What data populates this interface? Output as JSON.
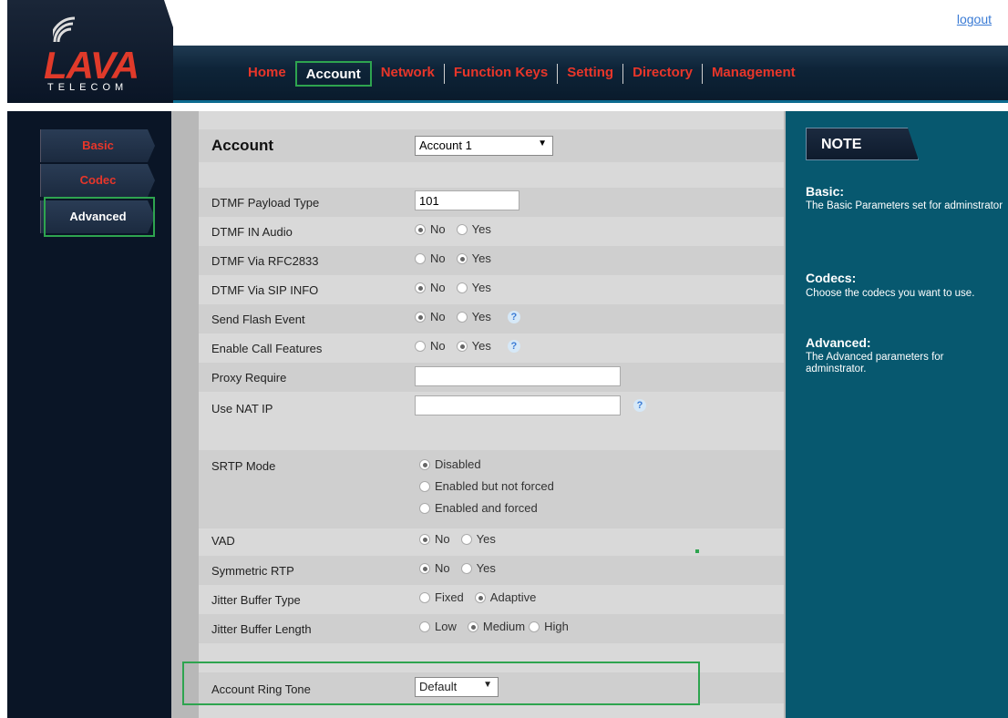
{
  "header": {
    "logout_label": "logout",
    "logo_text": "LAVA",
    "logo_sub": "TELECOM",
    "nav": [
      {
        "label": "Home"
      },
      {
        "label": "Account"
      },
      {
        "label": "Network"
      },
      {
        "label": "Function Keys"
      },
      {
        "label": "Setting"
      },
      {
        "label": "Directory"
      },
      {
        "label": "Management"
      }
    ],
    "active_nav": "Account"
  },
  "sidebar": {
    "items": [
      {
        "label": "Basic"
      },
      {
        "label": "Codec"
      },
      {
        "label": "Advanced"
      }
    ],
    "active": "Advanced"
  },
  "form": {
    "title": "Account",
    "account_select": "Account 1",
    "dtmf_payload_type": {
      "label": "DTMF Payload Type",
      "value": "101"
    },
    "dtmf_in_audio": {
      "label": "DTMF IN Audio",
      "options": [
        "No",
        "Yes"
      ],
      "selected": "No"
    },
    "dtmf_via_rfc2833": {
      "label": "DTMF Via RFC2833",
      "options": [
        "No",
        "Yes"
      ],
      "selected": "Yes"
    },
    "dtmf_via_sip_info": {
      "label": "DTMF Via SIP INFO",
      "options": [
        "No",
        "Yes"
      ],
      "selected": "No"
    },
    "send_flash_event": {
      "label": "Send Flash Event",
      "options": [
        "No",
        "Yes"
      ],
      "selected": "No"
    },
    "enable_call_features": {
      "label": "Enable Call Features",
      "options": [
        "No",
        "Yes"
      ],
      "selected": "Yes"
    },
    "proxy_require": {
      "label": "Proxy Require",
      "value": ""
    },
    "use_nat_ip": {
      "label": "Use NAT IP",
      "value": ""
    },
    "srtp_mode": {
      "label": "SRTP Mode",
      "options": [
        "Disabled",
        "Enabled but not forced",
        "Enabled and forced"
      ],
      "selected": "Disabled"
    },
    "vad": {
      "label": "VAD",
      "options": [
        "No",
        "Yes"
      ],
      "selected": "No"
    },
    "symmetric_rtp": {
      "label": "Symmetric RTP",
      "options": [
        "No",
        "Yes"
      ],
      "selected": "No"
    },
    "jitter_buffer_type": {
      "label": "Jitter Buffer Type",
      "options": [
        "Fixed",
        "Adaptive"
      ],
      "selected": "Adaptive"
    },
    "jitter_buffer_length": {
      "label": "Jitter Buffer Length",
      "options": [
        "Low",
        "Medium",
        "High"
      ],
      "selected": "Medium"
    },
    "account_ring_tone": {
      "label": "Account Ring Tone",
      "value": "Default"
    }
  },
  "note": {
    "tab_label": "NOTE",
    "sections": [
      {
        "heading": "Basic:",
        "text": "The Basic Parameters set for adminstrator"
      },
      {
        "heading": "Codecs:",
        "text": "Choose the codecs you want to use."
      },
      {
        "heading": "Advanced:",
        "text": "The Advanced parameters for adminstrator."
      }
    ]
  },
  "colors": {
    "accent_red": "#e8362a",
    "highlight_green": "#2ea44f",
    "note_bg": "#07586f",
    "dark_bg": "#0a1526"
  }
}
